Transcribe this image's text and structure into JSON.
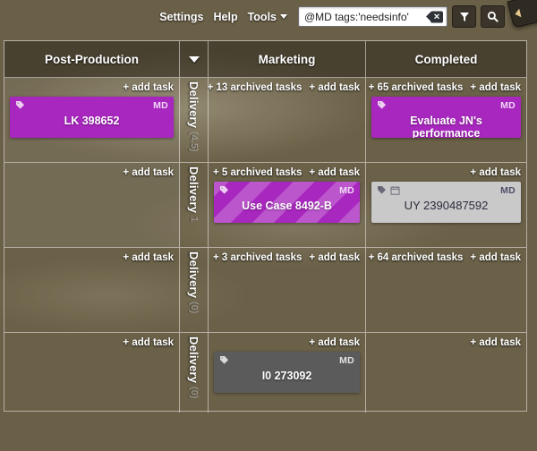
{
  "toolbar": {
    "menus": [
      {
        "label": "Settings",
        "caret": false
      },
      {
        "label": "Help",
        "caret": false
      },
      {
        "label": "Tools",
        "caret": true
      }
    ],
    "search": {
      "value": "@MD tags:'needsinfo'",
      "placeholder": "",
      "clear_icon": "clear-x-icon",
      "filter_icon": "filter-funnel-icon",
      "search_icon": "search-magnifier-icon"
    },
    "sidebar_toggle_icon": "arrow-left-icon"
  },
  "board": {
    "columns": [
      {
        "title": "Post-Production",
        "name": "post-production"
      },
      {
        "title": "",
        "name": "lane-header",
        "icon": "chevron-down-icon"
      },
      {
        "title": "Marketing",
        "name": "marketing"
      },
      {
        "title": "Completed",
        "name": "completed"
      }
    ],
    "add_task_label": "+ add task",
    "swimlanes": [
      {
        "name": "Delivery",
        "count": "(4.5)",
        "cells": [
          {
            "column": "post-production",
            "archived": null,
            "add_task": "+ add task",
            "cards": [
              {
                "title": "LK 398652",
                "assignee": "MD",
                "style": "purple",
                "icons": [
                  "tag-icon"
                ]
              }
            ]
          },
          {
            "column": "marketing",
            "archived": "+ 13 archived tasks",
            "add_task": "+ add task",
            "cards": []
          },
          {
            "column": "completed",
            "archived": "+ 65 archived tasks",
            "add_task": "+ add task",
            "cards": [
              {
                "title": "Evaluate JN's performance",
                "assignee": "MD",
                "style": "purple",
                "icons": [
                  "tag-icon"
                ]
              }
            ]
          }
        ]
      },
      {
        "name": "Delivery",
        "count": "1",
        "cells": [
          {
            "column": "post-production",
            "archived": null,
            "add_task": "+ add task",
            "cards": []
          },
          {
            "column": "marketing",
            "archived": "+ 5 archived tasks",
            "add_task": "+ add task",
            "cards": [
              {
                "title": "Use Case 8492-B",
                "assignee": "MD",
                "style": "striped",
                "icons": [
                  "tag-icon"
                ]
              }
            ]
          },
          {
            "column": "completed",
            "archived": null,
            "add_task": "+ add task",
            "cards": [
              {
                "title": "UY 2390487592",
                "assignee": "MD",
                "style": "gray-light",
                "icons": [
                  "tag-icon",
                  "calendar-icon"
                ]
              }
            ]
          }
        ]
      },
      {
        "name": "Delivery",
        "count": "(0)",
        "cells": [
          {
            "column": "post-production",
            "archived": null,
            "add_task": "+ add task",
            "cards": []
          },
          {
            "column": "marketing",
            "archived": "+ 3 archived tasks",
            "add_task": "+ add task",
            "cards": []
          },
          {
            "column": "completed",
            "archived": "+ 64 archived tasks",
            "add_task": "+ add task",
            "cards": []
          }
        ]
      },
      {
        "name": "Delivery",
        "count": "(0)",
        "cells": [
          {
            "column": "post-production",
            "archived": null,
            "add_task": "+ add task",
            "cards": []
          },
          {
            "column": "marketing",
            "archived": null,
            "add_task": "+ add task",
            "cards": [
              {
                "title": "I0 273092",
                "assignee": "MD",
                "style": "gray-dark",
                "icons": [
                  "tag-icon"
                ]
              }
            ]
          },
          {
            "column": "completed",
            "archived": null,
            "add_task": "+ add task",
            "cards": []
          }
        ]
      }
    ]
  },
  "colors": {
    "card_purple": "#a827be",
    "card_gray_light": "#c9c9c9",
    "card_gray_dark": "#5b5b5b",
    "toolbar_button": "#3a342b"
  }
}
